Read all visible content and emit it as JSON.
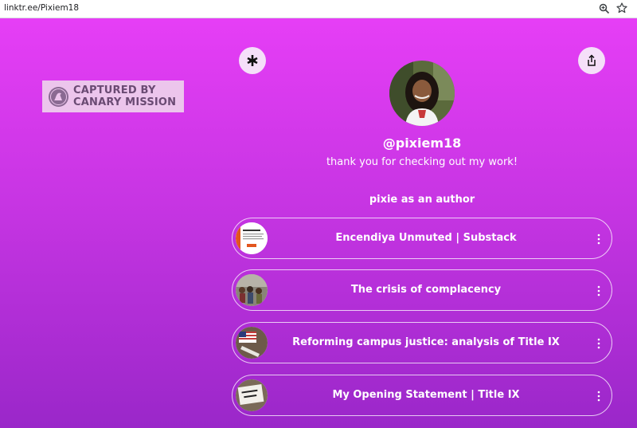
{
  "browser": {
    "url": "linktr.ee/Pixiem18",
    "zoom_icon": "zoom-icon",
    "bookmark_icon": "star-icon"
  },
  "stamp": {
    "text_line1": "CAPTURED BY",
    "text_line2": "CANARY MISSION",
    "icon": "canary-seal-icon"
  },
  "header": {
    "logo_icon": "linktree-logo-icon",
    "share_icon": "share-icon"
  },
  "profile": {
    "name": "@pixiem18",
    "bio": "thank you for checking out my work!"
  },
  "section": {
    "title": "pixie as an author"
  },
  "links": [
    {
      "title": "Encendiya Unmuted | Substack",
      "thumb": "substack-thumbnail"
    },
    {
      "title": "The crisis of complacency",
      "thumb": "crowd-thumbnail"
    },
    {
      "title": "Reforming campus justice: analysis of Title IX",
      "thumb": "flag-thumbnail"
    },
    {
      "title": "My Opening Statement | Title IX",
      "thumb": "protest-sign-thumbnail"
    }
  ],
  "colors": {
    "gradient_top": "#e63ef6",
    "gradient_bottom": "#9a27c9",
    "button_bg": "#f5dff9",
    "stamp_bg": "#ecc5ec",
    "stamp_text": "#6a4a73"
  }
}
